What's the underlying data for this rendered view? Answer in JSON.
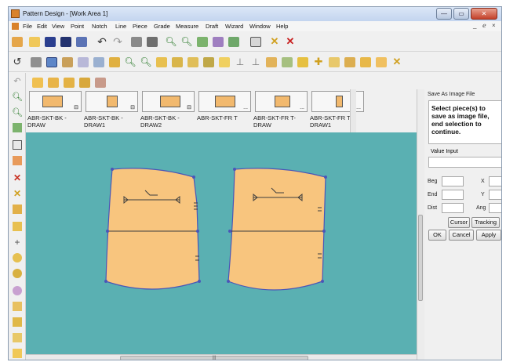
{
  "window": {
    "title": "Pattern Design - [Work Area 1]",
    "controls": [
      "—",
      "▭",
      "✕"
    ],
    "mdi_controls": [
      "_",
      "ℯ",
      "×"
    ]
  },
  "menu": [
    "File",
    "Edit",
    "View",
    "Point",
    "Notch",
    "Line",
    "Piece",
    "Grade",
    "Measure",
    "Draft",
    "Wizard",
    "Window",
    "Help"
  ],
  "pieces": [
    {
      "label": "ABR-SKT-BK -DRAW",
      "badge": "⊟"
    },
    {
      "label": "ABR-SKT-BK -DRAW1",
      "badge": "⊟"
    },
    {
      "label": "ABR-SKT-BK -DRAW2",
      "badge": "⊟"
    },
    {
      "label": "ABR-SKT-FR T",
      "badge": "..."
    },
    {
      "label": "ABR-SKT-FR T-DRAW",
      "badge": "..."
    },
    {
      "label": "ABR-SKT-FR T-DRAW1",
      "badge": "..."
    }
  ],
  "panel": {
    "title": "Save As Image File",
    "instruction": "Select piece(s) to save as image file, end selection to continue.",
    "value_input_label": "Value Input",
    "fields": {
      "beg": "Beg",
      "end": "End",
      "dist": "Dist",
      "x": "X",
      "y": "Y",
      "ang": "Ang"
    },
    "buttons": {
      "cursor": "Cursor",
      "tracking": "Tracking",
      "ok": "OK",
      "cancel": "Cancel",
      "apply": "Apply"
    }
  },
  "hscroll_label": "|||",
  "colors": {
    "canvas": "#5ab0b2",
    "piece_fill": "#f8c57e",
    "piece_outline": "#4a55b8"
  }
}
